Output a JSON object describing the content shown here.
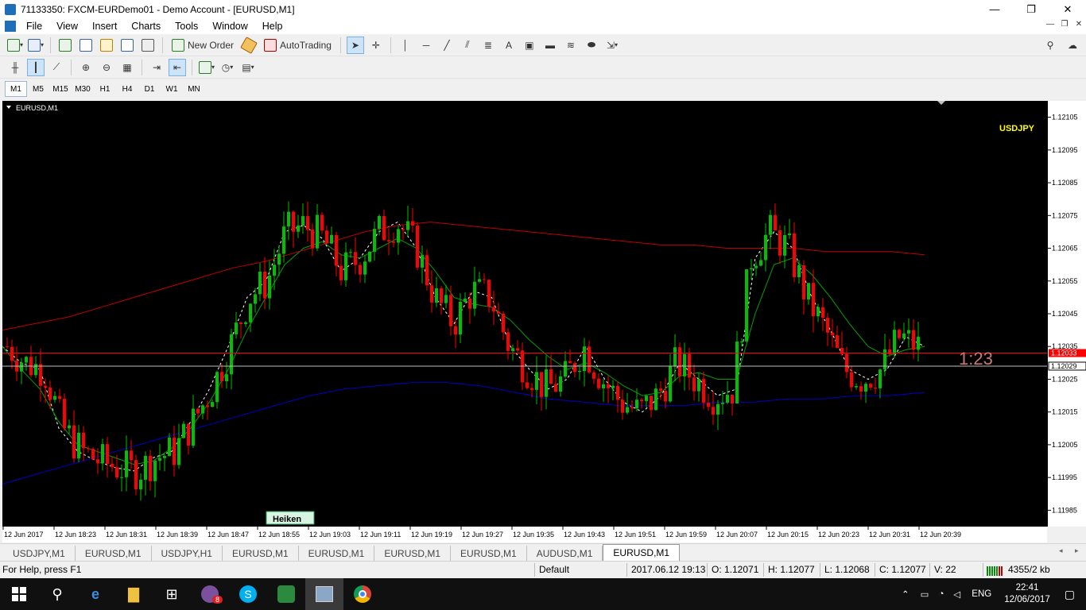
{
  "window": {
    "title": "71133350: FXCM-EURDemo01 - Demo Account - [EURUSD,M1]",
    "minimize": "—",
    "restore": "❐",
    "close": "✕"
  },
  "menu": [
    "File",
    "View",
    "Insert",
    "Charts",
    "Tools",
    "Window",
    "Help"
  ],
  "toolbar": {
    "new_order": "New Order",
    "auto_trading": "AutoTrading",
    "text_tool": "A",
    "dropdown": "▾"
  },
  "timeframes": [
    "M1",
    "M5",
    "M15",
    "M30",
    "H1",
    "H4",
    "D1",
    "W1",
    "MN"
  ],
  "active_timeframe": "M1",
  "chart": {
    "label": "EURUSD,M1",
    "overlay_symbol": "USDJPY",
    "overlay_timer": "1:23",
    "heiken_button": "Heiken",
    "bid_price": "1.12029",
    "ask_price": "1.12033",
    "colors": {
      "bull": "#00c000",
      "bear": "#ff0000",
      "background": "#000000",
      "ma_slow": "#c00000",
      "ma_long": "#0000c8",
      "ma_fast": "#ffffff",
      "ma_mid": "#00a000",
      "overlay_symbol": "#ffff00",
      "overlay_timer": "#c87878"
    }
  },
  "price_scale": [
    "1.12105",
    "1.12095",
    "1.12085",
    "1.12075",
    "1.12065",
    "1.12055",
    "1.12045",
    "1.12035",
    "1.12025",
    "1.12015",
    "1.12005",
    "1.11995",
    "1.11985"
  ],
  "time_scale": [
    "12 Jun 2017",
    "12 Jun 18:23",
    "12 Jun 18:31",
    "12 Jun 18:39",
    "12 Jun 18:47",
    "12 Jun 18:55",
    "12 Jun 19:03",
    "12 Jun 19:11",
    "12 Jun 19:19",
    "12 Jun 19:27",
    "12 Jun 19:35",
    "12 Jun 19:43",
    "12 Jun 19:51",
    "12 Jun 19:59",
    "12 Jun 20:07",
    "12 Jun 20:15",
    "12 Jun 20:23",
    "12 Jun 20:31",
    "12 Jun 20:39"
  ],
  "chart_tabs": [
    "USDJPY,M1",
    "EURUSD,M1",
    "USDJPY,H1",
    "EURUSD,M1",
    "EURUSD,M1",
    "EURUSD,M1",
    "EURUSD,M1",
    "AUDUSD,M1",
    "EURUSD,M1"
  ],
  "active_chart_tab": 8,
  "status": {
    "help": "For Help, press F1",
    "profile": "Default",
    "datetime": "2017.06.12 19:13",
    "open": "O: 1.12071",
    "high": "H: 1.12077",
    "low": "L: 1.12068",
    "close": "C: 1.12077",
    "volume": "V: 22",
    "traffic": "4355/2 kb"
  },
  "taskbar": {
    "viber_badge": "8",
    "language": "ENG",
    "time": "22:41",
    "date": "12/06/2017"
  },
  "chart_data": {
    "type": "candlestick",
    "symbol": "EURUSD",
    "timeframe": "M1",
    "ylim": [
      1.1198,
      1.1211
    ],
    "horizontal_lines": [
      1.12029,
      1.12033
    ],
    "series": [
      {
        "values": [
          1.12035,
          1.1203,
          1.12028,
          1.1201,
          1.12003,
          1.12,
          1.11998,
          1.11997,
          1.12001,
          1.12003,
          1.12012,
          1.12022,
          1.12035,
          1.1205,
          1.12055,
          1.1207,
          1.12072,
          1.12068,
          1.12058,
          1.12062,
          1.1207,
          1.12073,
          1.12065,
          1.1205,
          1.12042,
          1.12052,
          1.1205,
          1.12035,
          1.12028,
          1.12022,
          1.12025,
          1.12035,
          1.12025,
          1.12018,
          1.12015,
          1.1202,
          1.1203,
          1.12025,
          1.1202,
          1.12022,
          1.12062,
          1.1207,
          1.12065,
          1.1205,
          1.1204,
          1.12028,
          1.12025,
          1.12028,
          1.12038,
          1.12035
        ]
      },
      {
        "values": [
          1.12035,
          1.12028,
          1.12022,
          1.12012,
          1.12005,
          1.12003,
          1.12001,
          1.11999,
          1.12,
          1.12004,
          1.1201,
          1.12018,
          1.12028,
          1.1204,
          1.1205,
          1.1206,
          1.12065,
          1.12067,
          1.12063,
          1.12062,
          1.12065,
          1.12068,
          1.12065,
          1.12058,
          1.1205,
          1.12048,
          1.12047,
          1.12043,
          1.12037,
          1.12032,
          1.12028,
          1.1203,
          1.12027,
          1.12023,
          1.1202,
          1.12021,
          1.12026,
          1.12027,
          1.12025,
          1.12025,
          1.12045,
          1.1206,
          1.12062,
          1.12057,
          1.1205,
          1.12042,
          1.12035,
          1.12032,
          1.12034,
          1.12035
        ]
      },
      {
        "values": [
          1.1204,
          1.12042,
          1.12044,
          1.12047,
          1.1205,
          1.12053,
          1.12056,
          1.12059,
          1.12061,
          1.12064,
          1.12067,
          1.1207,
          1.12072,
          1.12073,
          1.12072,
          1.12071,
          1.1207,
          1.12069,
          1.12068,
          1.12067,
          1.12066,
          1.12066,
          1.12065,
          1.12065,
          1.12065,
          1.12064,
          1.12064,
          1.12064,
          1.12063
        ]
      },
      {
        "values": [
          1.11993,
          1.11996,
          1.11999,
          1.12002,
          1.12005,
          1.12008,
          1.12011,
          1.12014,
          1.12017,
          1.1202,
          1.12022,
          1.12023,
          1.12024,
          1.12024,
          1.12023,
          1.12021,
          1.12019,
          1.12018,
          1.12017,
          1.12017,
          1.12017,
          1.12018,
          1.12018,
          1.12019,
          1.12019,
          1.1202,
          1.1202,
          1.12021
        ]
      }
    ]
  }
}
